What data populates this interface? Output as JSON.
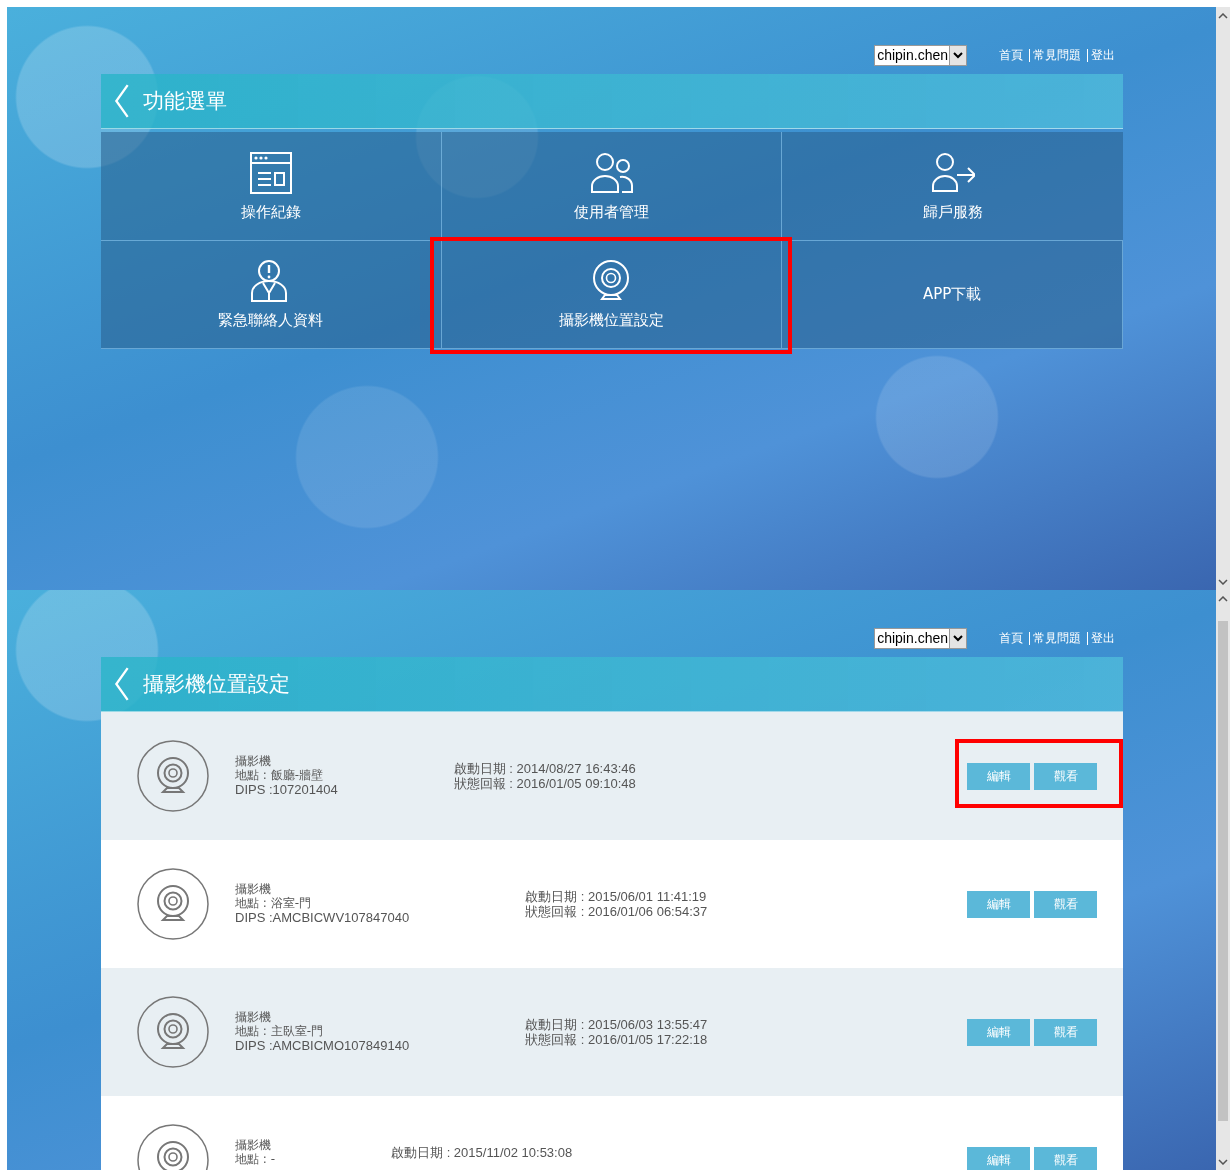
{
  "screens": [
    {
      "user_select": {
        "value": "chipin.chen"
      },
      "nav_links": [
        "首頁",
        "常見問題",
        "登出"
      ],
      "header": {
        "title": "功能選單"
      },
      "tiles": [
        {
          "label": "操作紀錄",
          "kind": "log",
          "highlighted": false
        },
        {
          "label": "使用者管理",
          "kind": "users",
          "highlighted": false
        },
        {
          "label": "歸戶服務",
          "kind": "transfer",
          "highlighted": false
        },
        {
          "label": "緊急聯絡人資料",
          "kind": "contact",
          "highlighted": false
        },
        {
          "label": "攝影機位置設定",
          "kind": "camera",
          "highlighted": true
        },
        {
          "label": "APP下載",
          "kind": "text",
          "highlighted": false
        }
      ]
    },
    {
      "user_select": {
        "value": "chipin.chen"
      },
      "nav_links": [
        "首頁",
        "常見問題",
        "登出"
      ],
      "header": {
        "title": "攝影機位置設定"
      },
      "cameras": [
        {
          "name": "攝影機",
          "location": "地點 : 飯廳-牆壁",
          "dips": "DIPS :107201404",
          "start": "啟動日期 : 2014/08/27 16:43:46",
          "report": "狀態回報 : 2016/01/05 09:10:48",
          "buttons": [
            "編輯",
            "觀看"
          ],
          "highlighted": true
        },
        {
          "name": "攝影機",
          "location": "地點 : 浴室-門",
          "dips": "DIPS :AMCBICWV107847040",
          "start": "啟動日期 : 2015/06/01 11:41:19",
          "report": "狀態回報 : 2016/01/06 06:54:37",
          "buttons": [
            "編輯",
            "觀看"
          ],
          "highlighted": false
        },
        {
          "name": "攝影機",
          "location": "地點 : 主臥室-門",
          "dips": "DIPS :AMCBICMO107849140",
          "start": "啟動日期 : 2015/06/03 13:55:47",
          "report": "狀態回報 : 2016/01/05 17:22:18",
          "buttons": [
            "編輯",
            "觀看"
          ],
          "highlighted": false
        },
        {
          "name": "攝影機",
          "location": "地點 : -",
          "start": "啟動日期 : 2015/11/02 10:53:08",
          "buttons": [
            "編輯",
            "觀看"
          ],
          "highlighted": false
        }
      ]
    }
  ]
}
